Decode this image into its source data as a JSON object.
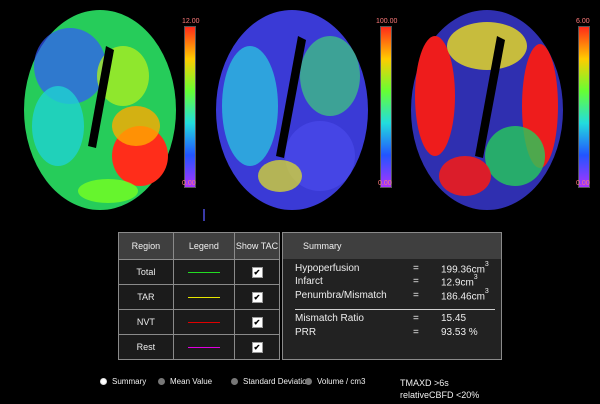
{
  "colorbars": {
    "left": {
      "max": "12.00",
      "min": "0.00"
    },
    "middle": {
      "max": "100.00",
      "min": "0.00"
    },
    "right": {
      "max": "6.00",
      "min": "0.00"
    }
  },
  "table": {
    "headers": [
      "Region",
      "Legend",
      "Show TAC"
    ],
    "rows": [
      {
        "region": "Total",
        "color": "#22dd22",
        "show_tac": true
      },
      {
        "region": "TAR",
        "color": "#e6e600",
        "show_tac": true
      },
      {
        "region": "NVT",
        "color": "#e00000",
        "show_tac": true
      },
      {
        "region": "Rest",
        "color": "#e000e0",
        "show_tac": true
      }
    ]
  },
  "summary": {
    "title": "Summary",
    "rows": [
      {
        "label": "Hypoperfusion",
        "eq": "=",
        "value": "199.36cm",
        "sup": "3"
      },
      {
        "label": "Infarct",
        "eq": "=",
        "value": "12.9cm",
        "sup": "3"
      },
      {
        "label": "Penumbra/Mismatch",
        "eq": "=",
        "value": "186.46cm",
        "sup": "3"
      },
      {
        "label": "Mismatch Ratio",
        "eq": "=",
        "value": "15.45",
        "sup": ""
      },
      {
        "label": "PRR",
        "eq": "=",
        "value": "93.53 %",
        "sup": ""
      }
    ]
  },
  "display_options": {
    "options": [
      "Summary",
      "Mean Value",
      "Standard Deviation",
      "Volume / cm3"
    ],
    "selected": "Summary"
  },
  "thresholds": {
    "line1": "TMAXD >6s",
    "line2": "relativeCBFD <20%"
  }
}
